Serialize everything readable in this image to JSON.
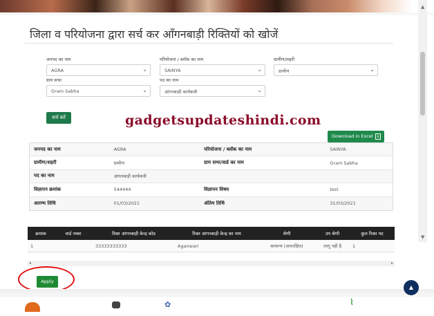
{
  "page": {
    "heading": "जिला व परियोजना द्वारा सर्च कर आँगनबाड़ी रिक्तियों को खोजें",
    "watermark": "gadgetsupdateshindi.com"
  },
  "form": {
    "district_label": "जनपद का नाम",
    "district_value": "AGRA",
    "project_label": "परियोजना / ब्लॉक का नाम",
    "project_value": "SAINYA",
    "area_label": "ग्रामीण/शहरी",
    "area_value": "ग्रामीण",
    "village_label": "ग्राम सभा",
    "village_value": "Gram Sabha",
    "post_label": "पद का नाम",
    "post_value": "आंगनबाड़ी कार्यकत्री",
    "search_label": "सर्च करें"
  },
  "excel_button": "Download in Excel",
  "details": [
    {
      "k1": "जनपद का नाम",
      "v1": "AGRA",
      "k2": "परियोजना / ब्लॉक का नाम",
      "v2": "SAINYA"
    },
    {
      "k1": "ग्रामीण/शहरी",
      "v1": "ग्रामीण",
      "k2": "ग्राम सभा/वार्ड का नाम",
      "v2": "Gram Sabha"
    },
    {
      "k1": "पद का नाम",
      "v1": "आंगनबाड़ी कार्यकत्री",
      "k2": "",
      "v2": ""
    },
    {
      "k1": "विज्ञापन क्रमांक",
      "v1": "544444",
      "k2": "विज्ञापन विषय",
      "v2": "test"
    },
    {
      "k1": "आरम्भ तिथि",
      "v1": "01/03/2021",
      "k2": "अंतिम तिथि",
      "v2": "31/03/2021"
    }
  ],
  "results": {
    "headers": [
      "क्रमांक",
      "वार्ड नम्बर",
      "रिक्त आंगनबाड़ी केन्द्र कोड",
      "रिक्त आंगनबाड़ी केन्द्र का नाम",
      "श्रेणी",
      "उप श्रेणी",
      "कुल रिक्त पद"
    ],
    "rows": [
      [
        "1",
        "",
        "33333333333",
        "Aganwari",
        "सामान्य (अनारक्षित)",
        "लागू नहीं है",
        "1"
      ]
    ]
  },
  "apply_label": "Apply"
}
